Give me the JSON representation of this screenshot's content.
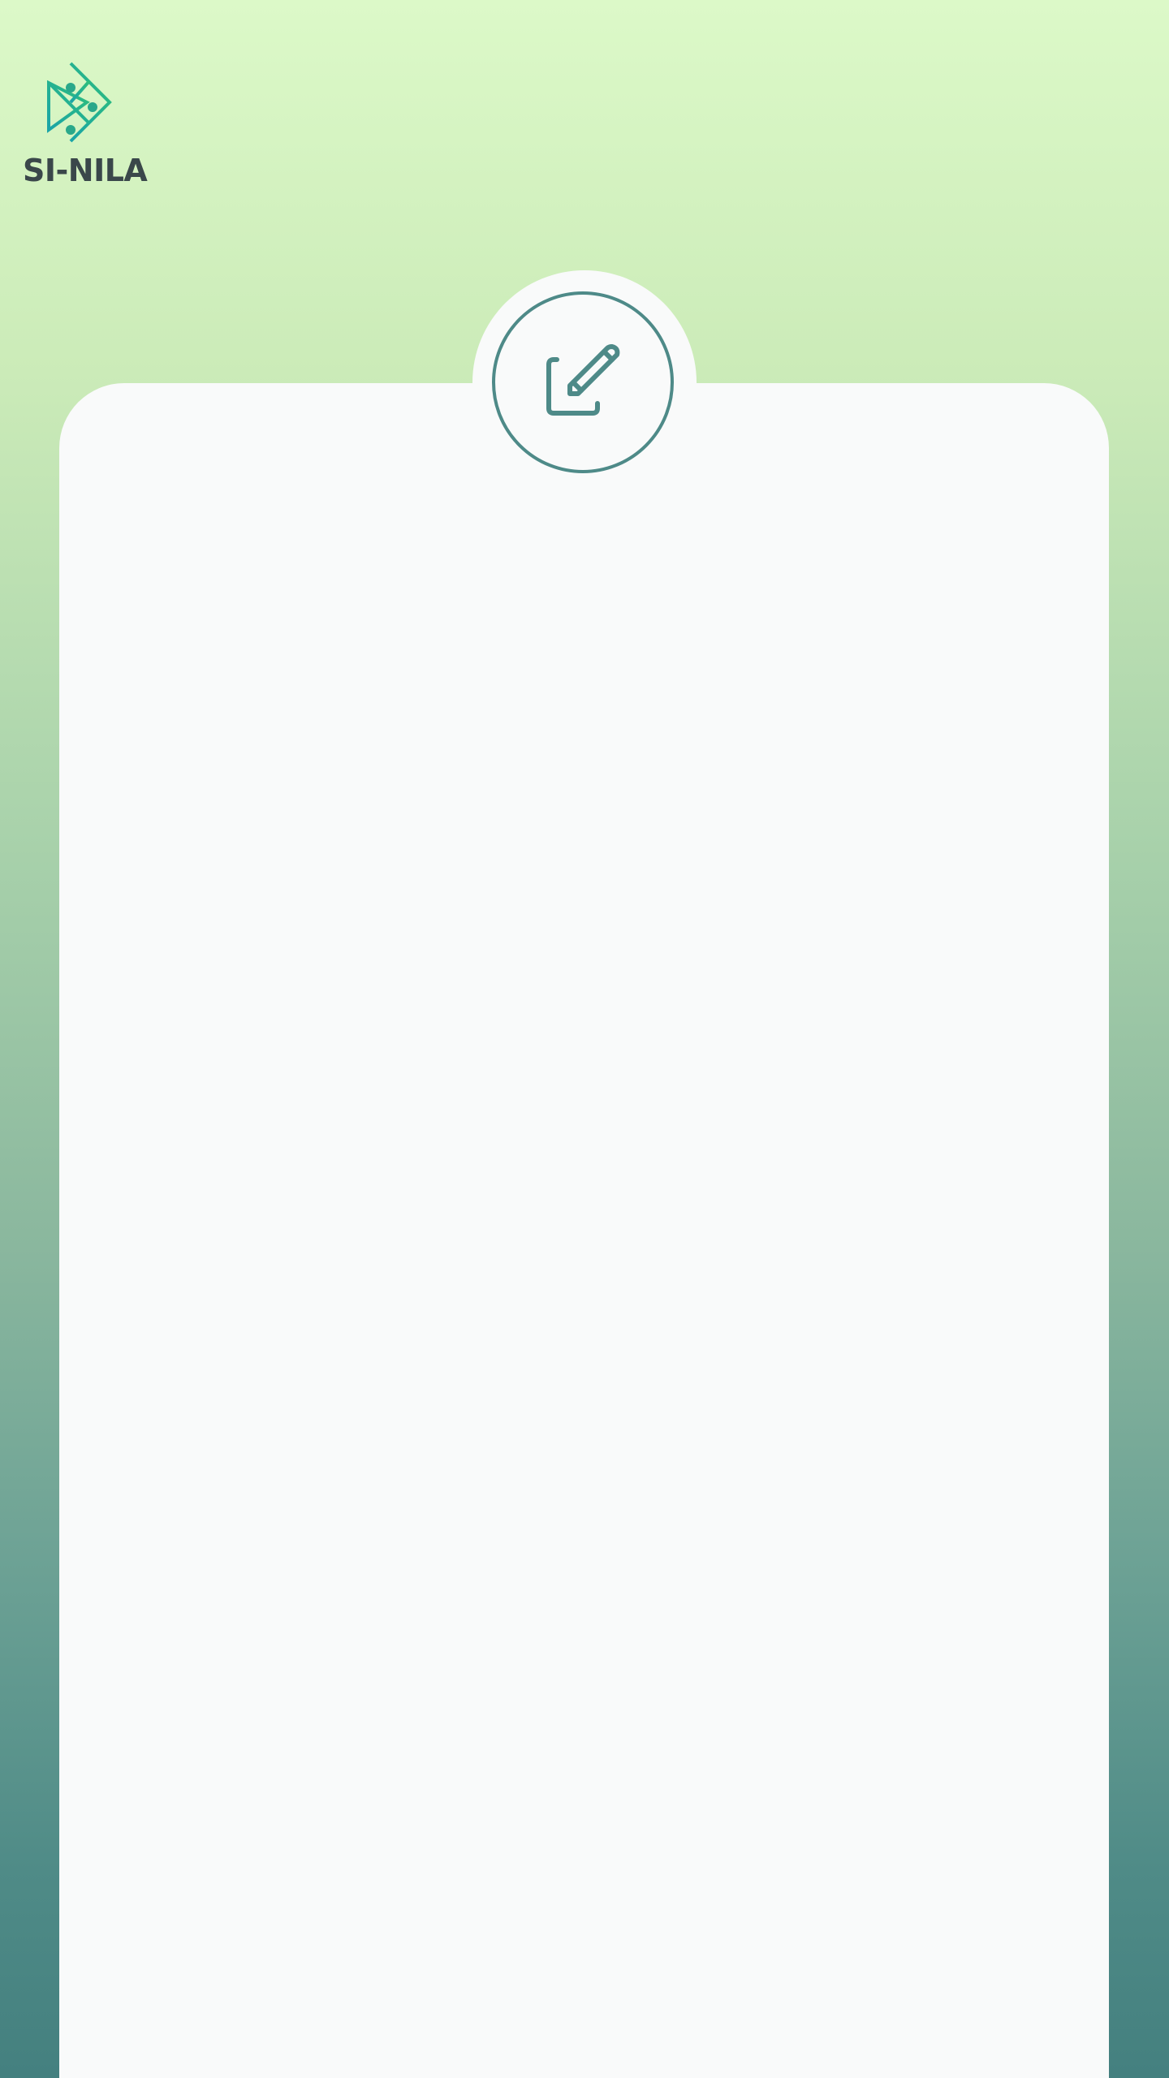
{
  "brand": {
    "name": "SI-NILA",
    "logo_icon": "fish-circuit-logo",
    "colors": {
      "logo_teal": "#1aa4a8",
      "logo_green": "#2fbf7a",
      "text_dark": "#3a474a"
    }
  },
  "edit_action": {
    "icon": "edit-icon",
    "color": "#4e8a88"
  },
  "theme": {
    "gradient_top": "#dcf9c8",
    "gradient_bottom": "#44807f",
    "card_bg": "#f9fafa"
  }
}
